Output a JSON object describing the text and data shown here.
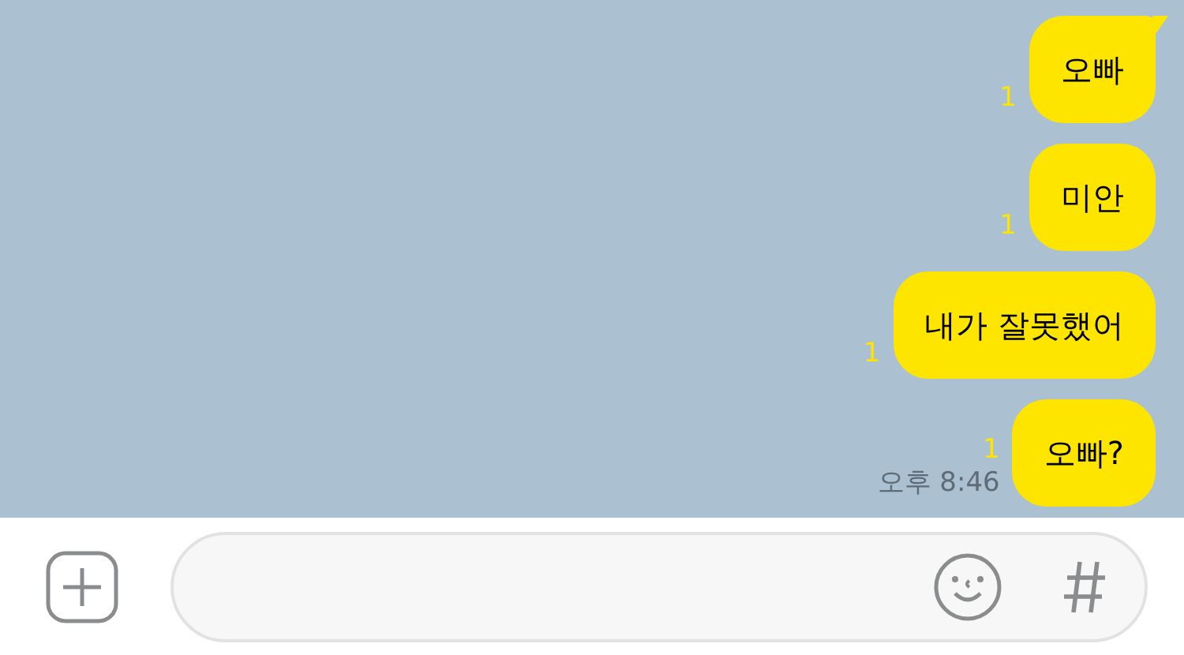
{
  "messages": [
    {
      "text": "오빠",
      "unread": "1",
      "tail": true
    },
    {
      "text": "미안",
      "unread": "1",
      "tail": false
    },
    {
      "text": "내가 잘못했어",
      "unread": "1",
      "tail": false
    },
    {
      "text": "오빠?",
      "unread": "1",
      "tail": false,
      "time": "오후 8:46"
    }
  ]
}
